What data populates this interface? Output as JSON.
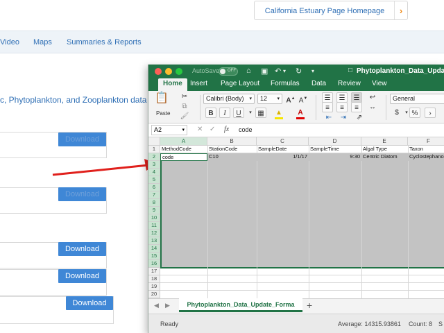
{
  "website": {
    "homepage_link": "California Estuary Page Homepage",
    "nav": [
      "Video",
      "Maps",
      "Summaries & Reports"
    ],
    "intro_text": "c, Phytoplankton, and Zooplankton data on t",
    "download_label": "Download"
  },
  "excel": {
    "autosave_label": "AutoSave",
    "autosave_state": "OFF",
    "doc_title": "Phytoplankton_Data_Update",
    "tabs": [
      "Home",
      "Insert",
      "Page Layout",
      "Formulas",
      "Data",
      "Review",
      "View"
    ],
    "font_name": "Calibri (Body)",
    "font_size": "12",
    "number_format": "General",
    "paste_label": "Paste",
    "name_box": "A2",
    "formula_value": "code",
    "columns": [
      "A",
      "B",
      "C",
      "D",
      "E",
      "F"
    ],
    "rows": [
      "1",
      "2",
      "3",
      "4",
      "5",
      "6",
      "7",
      "8",
      "9",
      "10",
      "11",
      "12",
      "13",
      "14",
      "15",
      "16",
      "17",
      "18",
      "19",
      "20"
    ],
    "header_row": [
      "MethodCode",
      "StationCode",
      "SampleDate",
      "SampleTime",
      "Algal Type",
      "Taxon"
    ],
    "data_row": [
      "code",
      "C10",
      "1/1/17",
      "9:30",
      "Centric Diatom",
      "Cyclostephanos"
    ],
    "sheet_tab": "Phytoplankton_Data_Update_Forma",
    "status_ready": "Ready",
    "status_average": "Average: 14315.93861",
    "status_count": "Count: 8",
    "status_s": "S"
  }
}
